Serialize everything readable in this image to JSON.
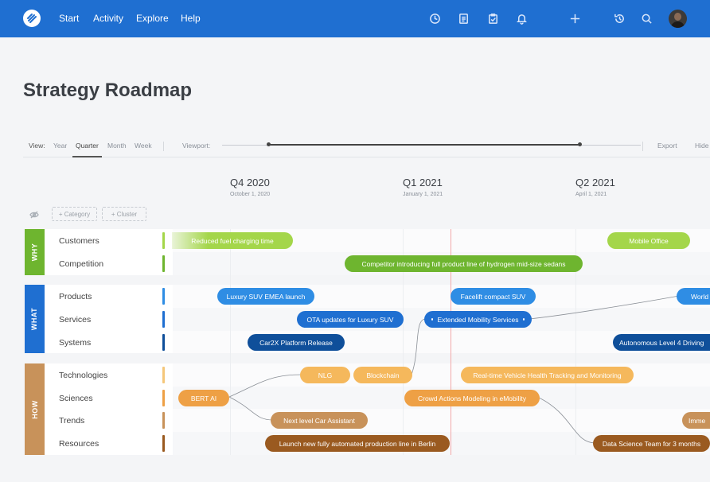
{
  "nav": {
    "items": [
      "Start",
      "Activity",
      "Explore",
      "Help"
    ]
  },
  "page": {
    "title": "Strategy Roadmap"
  },
  "toolbar": {
    "view_label": "View:",
    "view_options": [
      "Year",
      "Quarter",
      "Month",
      "Week"
    ],
    "active_view": "Quarter",
    "viewport_label": "Viewport:",
    "export_label": "Export",
    "hide_label": "Hide"
  },
  "quarters": [
    {
      "title": "Q4 2020",
      "date": "October 1, 2020"
    },
    {
      "title": "Q1 2021",
      "date": "January 1, 2021"
    },
    {
      "title": "Q2 2021",
      "date": "April 1, 2021"
    }
  ],
  "filters": {
    "category_label": "+ Category",
    "cluster_label": "+ Cluster"
  },
  "groups": {
    "why": {
      "label": "WHY",
      "color": "#6eb52f",
      "rows": [
        "Customers",
        "Competition"
      ]
    },
    "what": {
      "label": "WHAT",
      "color": "#1f6fd1",
      "rows": [
        "Products",
        "Services",
        "Systems"
      ]
    },
    "how": {
      "label": "HOW",
      "color": "#c8925a",
      "rows": [
        "Technologies",
        "Sciences",
        "Trends",
        "Resources"
      ]
    }
  },
  "bars": {
    "b1": "Reduced fuel charging time",
    "b2": "Mobile Office",
    "b3": "Competitor introducing full product line of hydrogen mid-size sedans",
    "b4": "Luxury SUV EMEA launch",
    "b5": "Facelift compact SUV",
    "b6": "World",
    "b7": "OTA updates for Luxury SUV",
    "b8": "Extended Mobility Services",
    "b9": "Car2X Platform Release",
    "b10": "Autonomous Level 4 Driving",
    "b11": "NLG",
    "b12": "Blockchain",
    "b13": "Real-time Vehicle Health Tracking and Monitoring",
    "b14": "BERT AI",
    "b15": "Crowd Actions Modeling in eMobility",
    "b16": "Next level Car Assistant",
    "b17": "Imme",
    "b18": "Launch new fully automated production line in Berlin",
    "b19": "Data Science Team for 3 months"
  },
  "colors": {
    "topbar": "#1f6fd1",
    "lime": "#a4d64a",
    "green": "#6eb52f",
    "blue_light": "#2f8de4",
    "blue": "#1f6fd1",
    "blue_dark": "#0f4f9a",
    "orange_light": "#f5b85c",
    "orange": "#eea045",
    "tan": "#c8925a",
    "brown": "#9a5a20"
  }
}
